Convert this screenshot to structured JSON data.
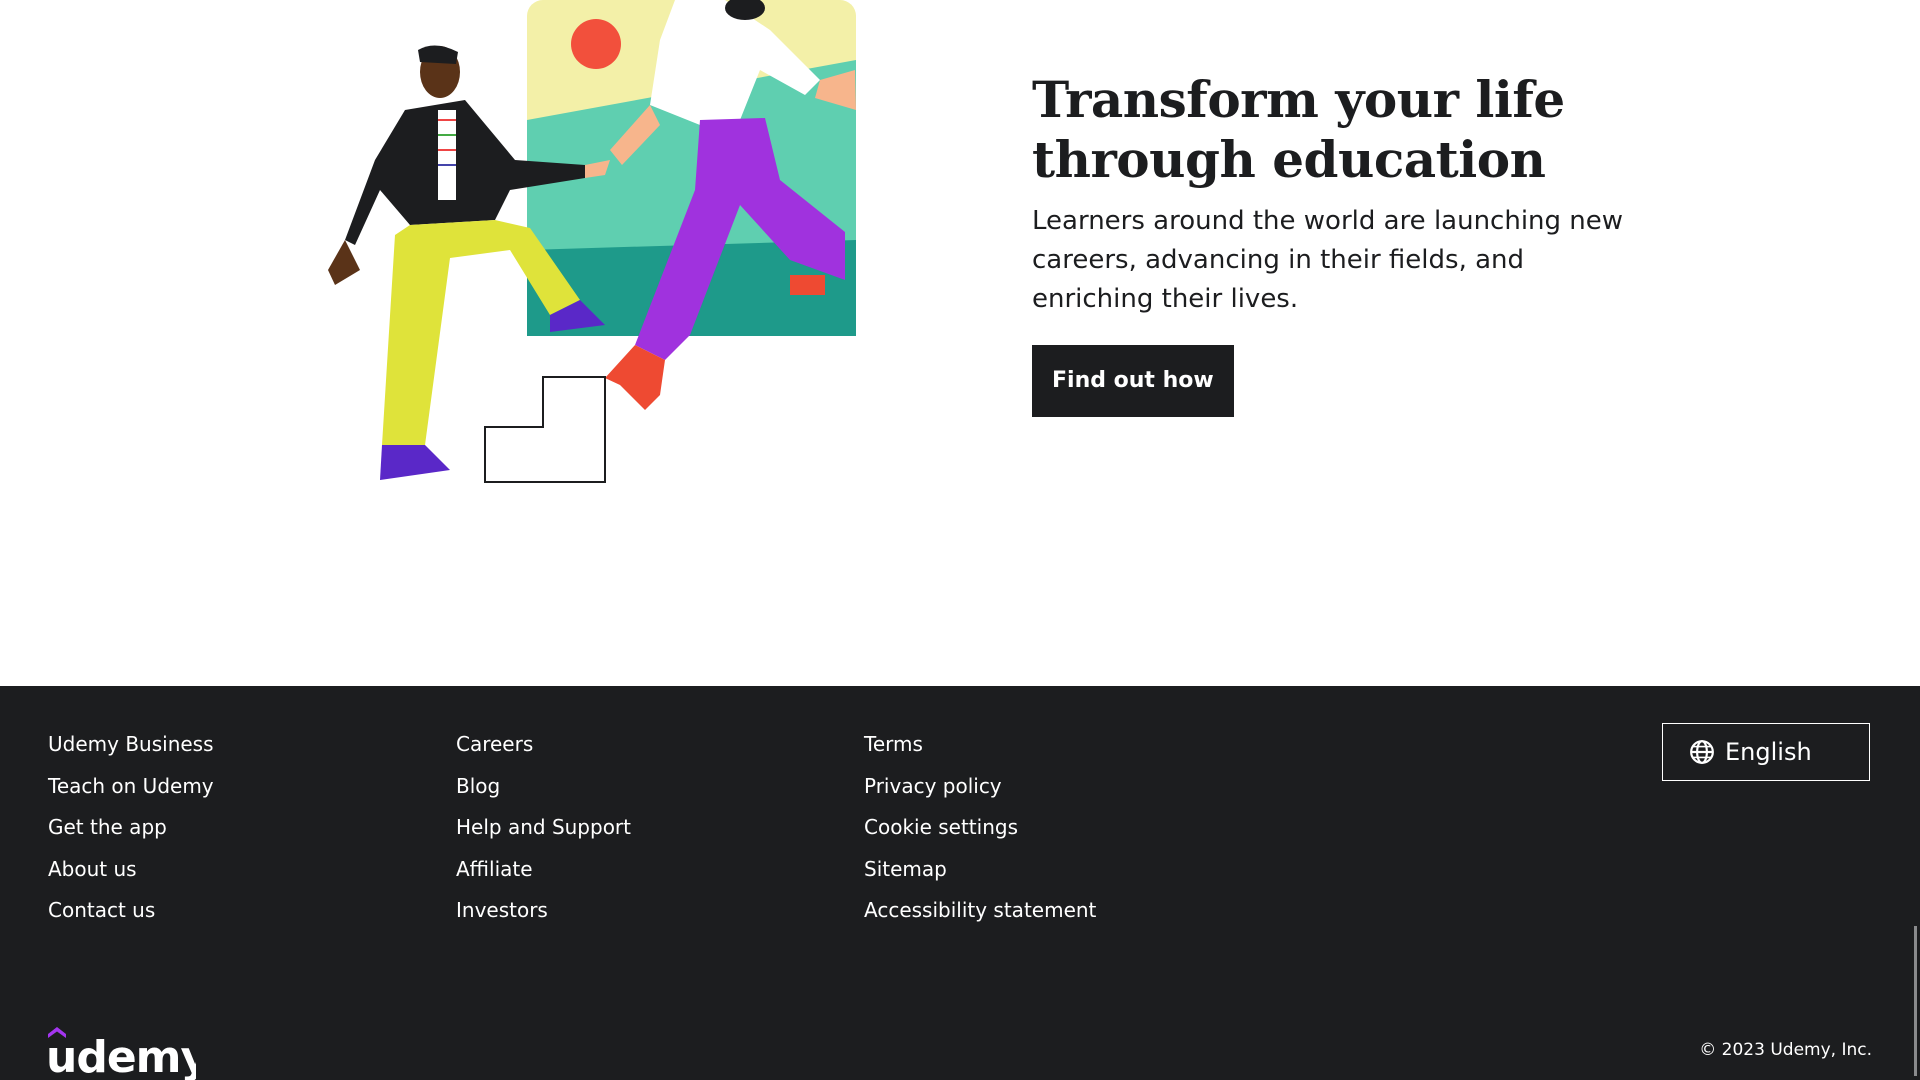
{
  "hero": {
    "title": "Transform your life through education",
    "subtitle": "Learners around the world are launching new careers, advancing in their fields, and enriching their lives.",
    "button_label": "Find out how"
  },
  "footer": {
    "col1": [
      "Udemy Business",
      "Teach on Udemy",
      "Get the app",
      "About us",
      "Contact us"
    ],
    "col2": [
      "Careers",
      "Blog",
      "Help and Support",
      "Affiliate",
      "Investors"
    ],
    "col3": [
      "Terms",
      "Privacy policy",
      "Cookie settings",
      "Sitemap",
      "Accessibility statement"
    ],
    "language_label": "English",
    "language_icon": "globe-icon",
    "logo_text": "udemy",
    "copyright": "© 2023 Udemy, Inc."
  },
  "colors": {
    "footer_bg": "#1c1d1f",
    "button_bg": "#1c1d1f",
    "brand_purple": "#a435f0"
  }
}
